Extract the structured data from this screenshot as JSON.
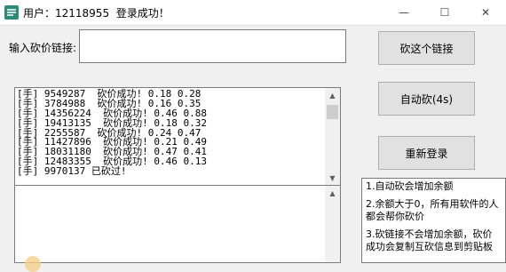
{
  "window": {
    "title": "用户：12118955  登录成功！",
    "controls": {
      "minimize": "—",
      "maximize": "☐",
      "close": "✕"
    }
  },
  "form": {
    "input_label": "输入砍价链接:",
    "url_value": ""
  },
  "buttons": {
    "cut": "砍这个链接",
    "auto": "自动砍(4s)",
    "relogin": "重新登录"
  },
  "log": [
    "[手] 9549287  砍价成功! 0.18 0.28",
    "[手] 3784988  砍价成功! 0.16 0.35",
    "[手] 14356224  砍价成功! 0.46 0.88",
    "[手] 19413135  砍价成功! 0.18 0.32",
    "[手] 2255587  砍价成功! 0.24 0.47",
    "[手] 11427896  砍价成功! 0.21 0.49",
    "[手] 18031180  砍价成功! 0.47 0.41",
    "[手] 12483355  砍价成功! 0.46 0.13",
    "[手] 9970137 已砍过!"
  ],
  "notes": [
    "1.自动砍会增加余额",
    "2.余额大于0，所有用软件的人都会帮你砍价",
    "3.砍链接不会增加余额，砍价成功会复制互砍信息到剪贴板"
  ],
  "icons": {
    "app": "app-logo-icon",
    "scroll_up": "scroll-up-arrow-icon",
    "scroll_down": "scroll-down-arrow-icon"
  },
  "colors": {
    "app_icon": "#2e8b7a",
    "button_face": "#e1e1e1",
    "window_bg": "#f0f0f0"
  }
}
